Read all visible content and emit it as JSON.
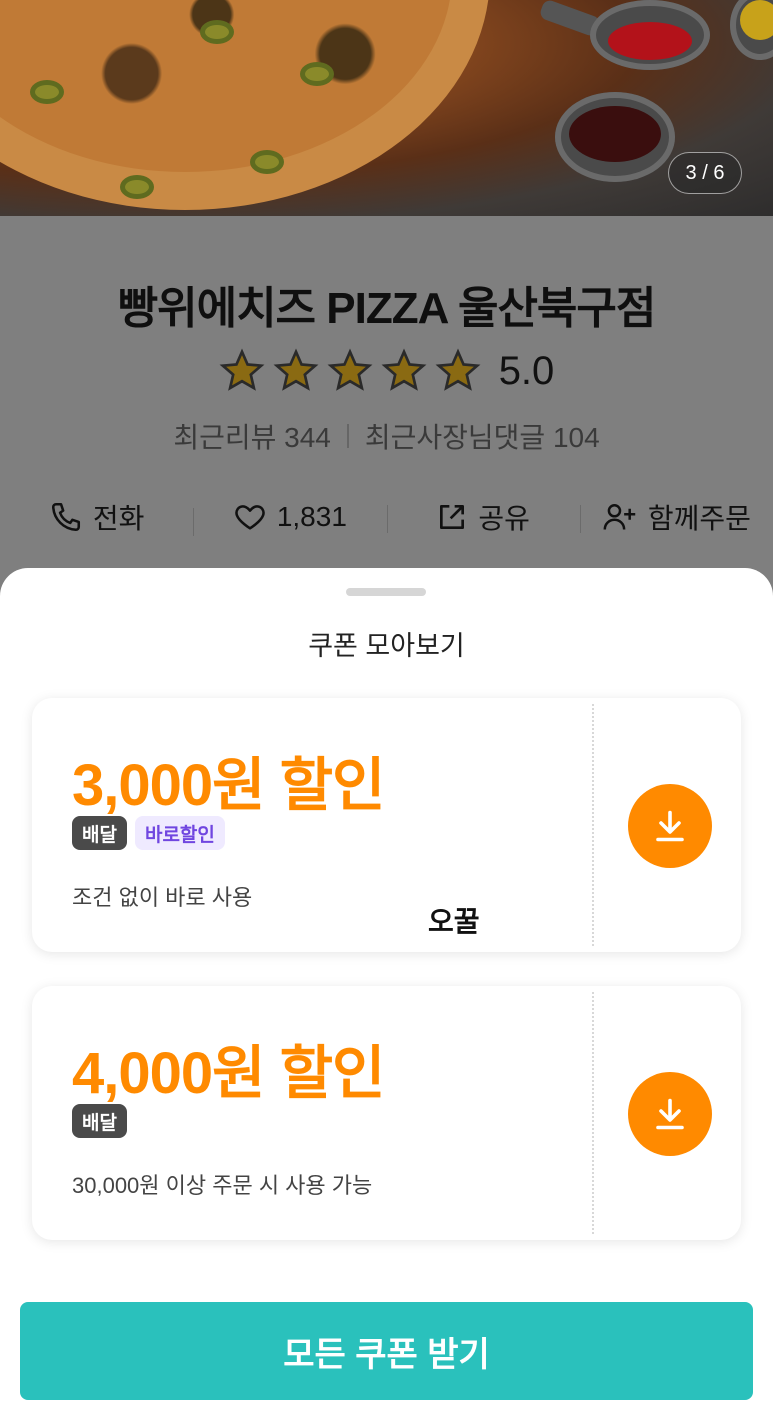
{
  "hero": {
    "counter": "3 / 6"
  },
  "store": {
    "name": "빵위에치즈 PIZZA 울산북구점",
    "rating": "5.0",
    "stars": 5,
    "recent_reviews": "최근리뷰 344",
    "owner_replies": "최근사장님댓글 104"
  },
  "actions": {
    "call": "전화",
    "likes": "1,831",
    "share": "공유",
    "group_order": "함께주문"
  },
  "sheet": {
    "title": "쿠폰 모아보기",
    "coupons": [
      {
        "amount": "3,000원 할인",
        "tags": [
          "배달",
          "바로할인"
        ],
        "condition": "조건 없이 바로 사용",
        "note": "오꿀"
      },
      {
        "amount": "4,000원 할인",
        "tags": [
          "배달"
        ],
        "condition": "30,000원 이상 주문 시 사용 가능"
      }
    ],
    "get_all_label": "모든 쿠폰 받기"
  },
  "colors": {
    "accent": "#ff8a00",
    "primary": "#2ac1bc",
    "tag_purple": "#7046e0"
  }
}
